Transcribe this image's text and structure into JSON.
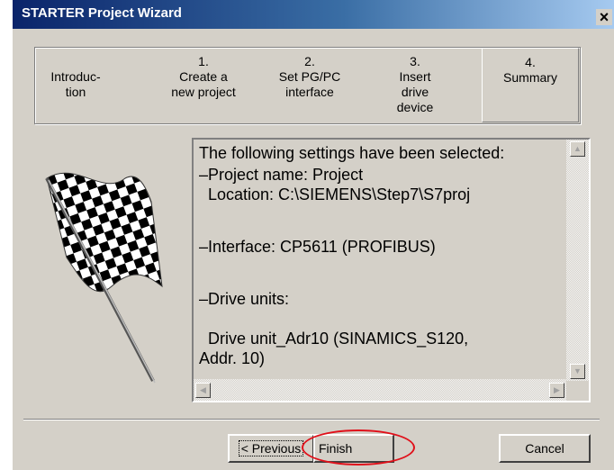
{
  "window": {
    "title": "STARTER Project Wizard",
    "close_glyph": "×"
  },
  "steps": [
    {
      "label": "\nIntroduc-\ntion",
      "selected": false
    },
    {
      "label": "1.\nCreate a\nnew project",
      "selected": false
    },
    {
      "label": "2.\nSet PG/PC\ninterface",
      "selected": false
    },
    {
      "label": "3.\nInsert\ndrive\ndevice",
      "selected": false
    },
    {
      "label": "4.\nSummary",
      "selected": true
    }
  ],
  "summary": {
    "heading": "The following settings have been selected:",
    "project_line": "–Project name: Project",
    "location_line": "  Location: C:\\SIEMENS\\Step7\\S7proj",
    "interface_line": "–Interface: CP5611 (PROFIBUS)",
    "drive_units_line": "–Drive units:",
    "drive_unit_line1": "  Drive unit_Adr10 (SINAMICS_S120,",
    "drive_unit_line2": "Addr. 10)"
  },
  "buttons": {
    "previous": "< Previous",
    "finish": "Finish",
    "cancel": "Cancel"
  },
  "icons": {
    "flag": "checkered-flag-icon",
    "scroll_up": "▲",
    "scroll_down": "▼",
    "scroll_left": "◀",
    "scroll_right": "▶"
  },
  "colors": {
    "highlight_circle": "#e0101a",
    "titlebar": "#0a246a"
  }
}
